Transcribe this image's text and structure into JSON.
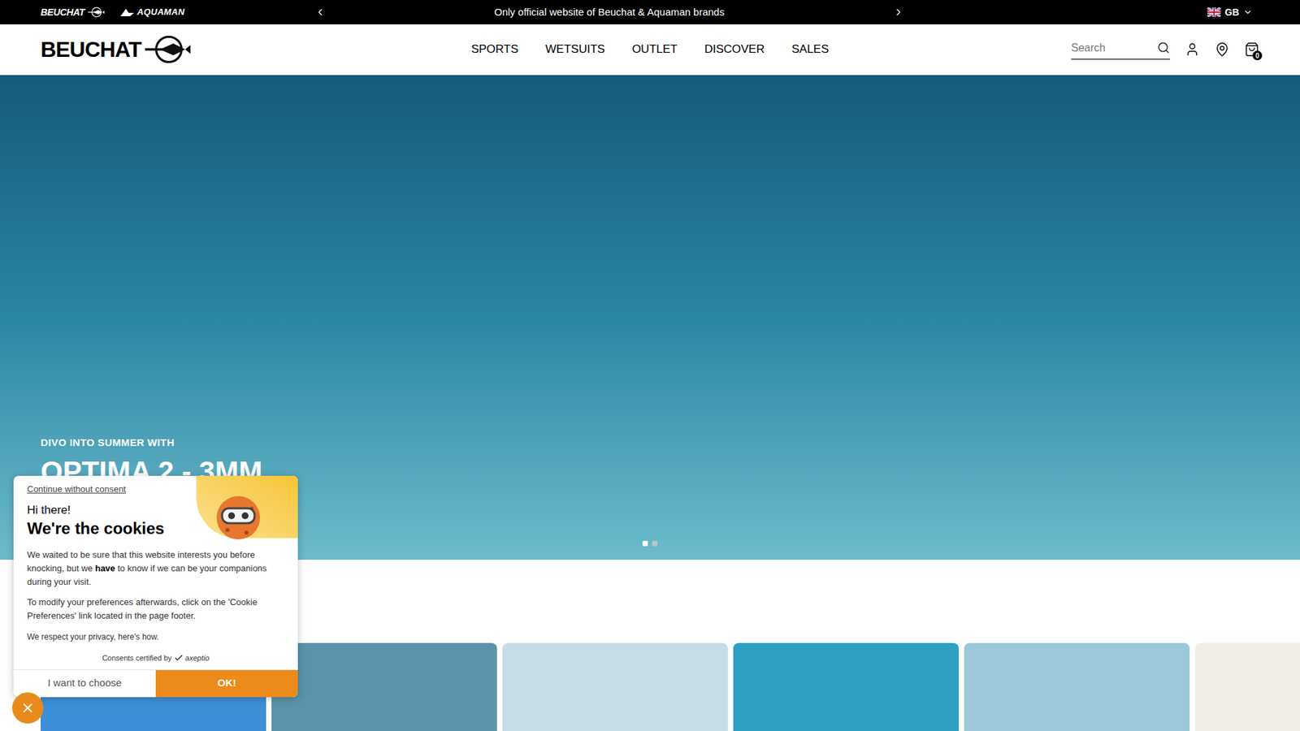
{
  "topbar": {
    "brands": [
      "BEUCHAT",
      "AQUAMAN"
    ],
    "announcement": "Only official website of Beuchat & Aquaman brands",
    "region": "GB"
  },
  "header": {
    "logo": "BEUCHAT",
    "nav": [
      "SPORTS",
      "WETSUITS",
      "OUTLET",
      "DISCOVER",
      "SALES"
    ],
    "search": {
      "placeholder": "Search"
    },
    "cart_count": "0"
  },
  "hero": {
    "eyebrow": "DIVO INTO SUMMER WITH",
    "title": "OPTIMA 2 - 3MM",
    "slides": [
      {
        "selected": true
      },
      {
        "selected": false
      }
    ]
  },
  "cards": [
    {
      "color": "#3d8fd8"
    },
    {
      "color": "#5b93ab"
    },
    {
      "color": "#c7dde5"
    },
    {
      "color": "#2f9fc4"
    },
    {
      "color": "#9cc9da"
    },
    {
      "color": "#f1ede7"
    }
  ],
  "cookie_banner": {
    "skip_link": "Continue without consent",
    "greeting": "Hi there!",
    "title": "We're the cookies",
    "paragraphs": [
      [
        {
          "text": "We waited to be sure that this website interests you before knocking, but we ",
          "bold": false
        },
        {
          "text": "have",
          "bold": true
        },
        {
          "text": " to know if we can be your companions during your visit.",
          "bold": false
        }
      ],
      [
        {
          "text": "To modify your preferences afterwards, click on the 'Cookie Preferences' link located in the page footer.",
          "bold": false
        }
      ]
    ],
    "privacy": "We respect your privacy, here's how.",
    "certified": "Consents certified by",
    "certifier": "axeptio",
    "buttons": [
      {
        "label": "I want to choose",
        "primary": false
      },
      {
        "label": "OK!",
        "primary": true
      }
    ]
  }
}
